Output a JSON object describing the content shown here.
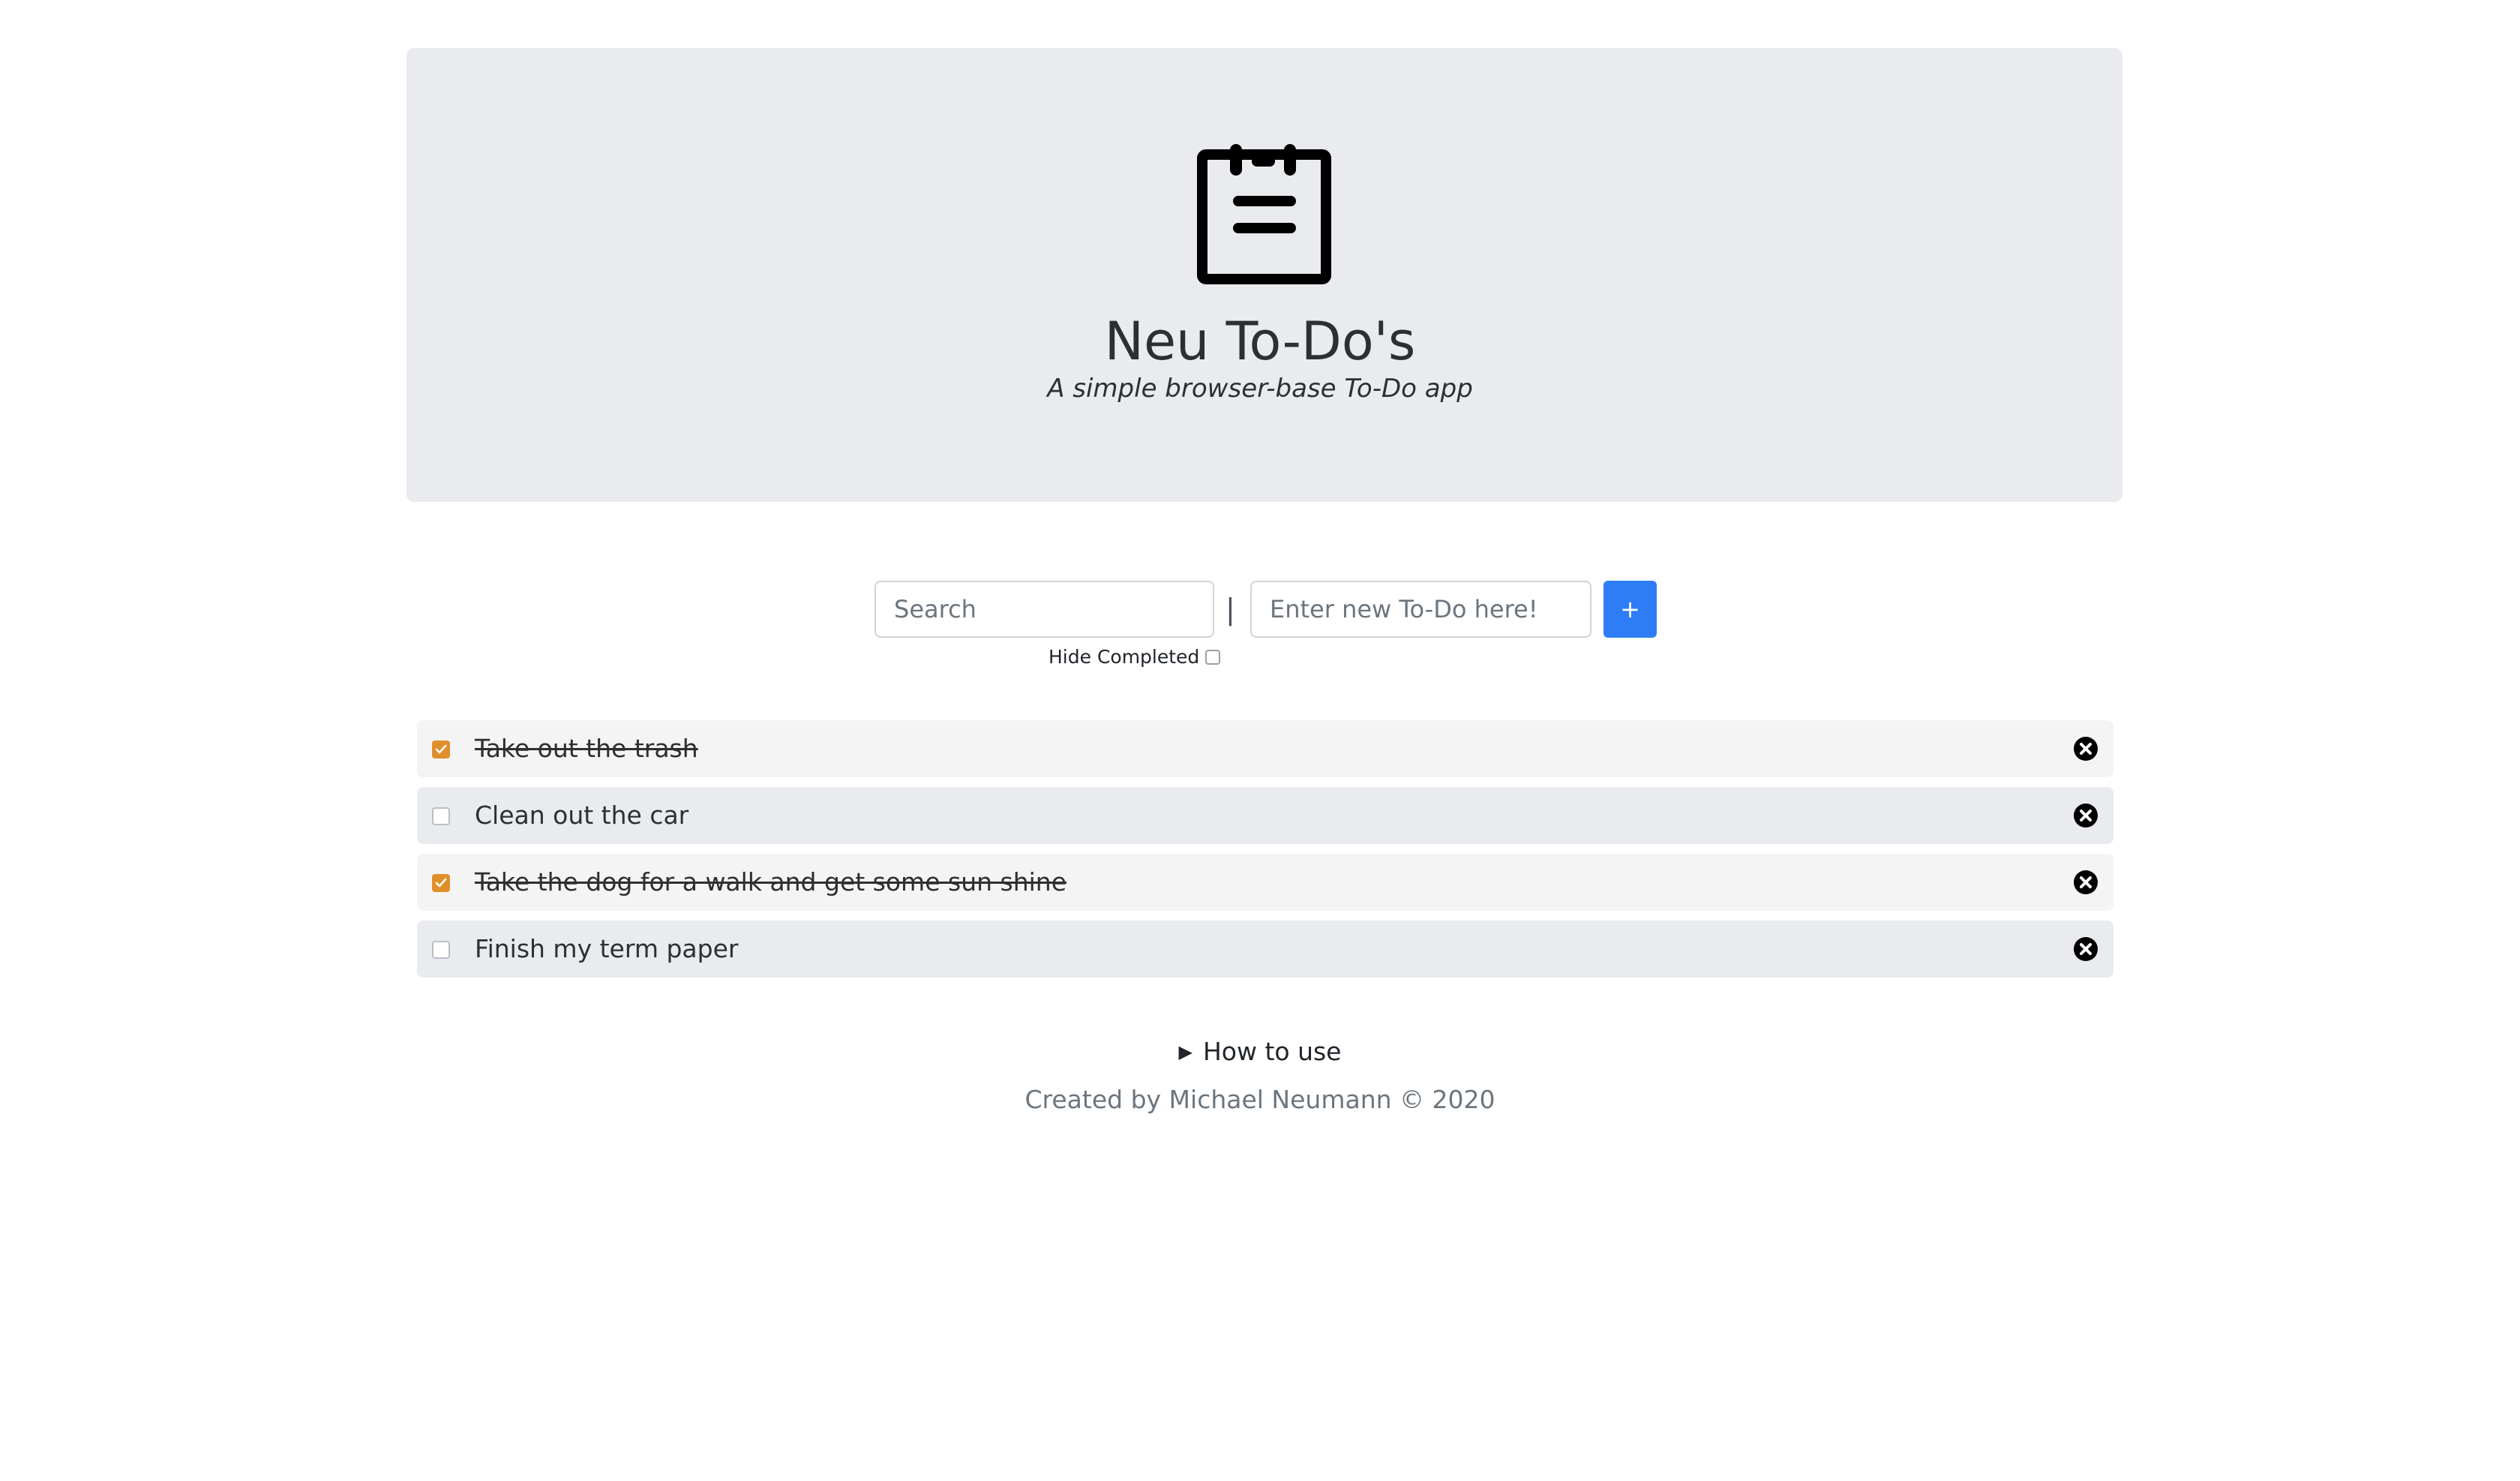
{
  "header": {
    "logo_icon": "notepad-icon",
    "title": "Neu To-Do's",
    "subtitle": "A simple browser-base To-Do app"
  },
  "form": {
    "search_placeholder": "Search",
    "separator": "|",
    "new_todo_placeholder": "Enter new To-Do here!",
    "add_button_label": "+",
    "hide_completed_label": "Hide Completed",
    "hide_completed_checked": false
  },
  "todos": [
    {
      "text": "Take out the trash",
      "completed": true
    },
    {
      "text": "Clean out the car",
      "completed": false
    },
    {
      "text": "Take the dog for a walk and get some sun shine",
      "completed": true
    },
    {
      "text": "Finish my term paper",
      "completed": false
    }
  ],
  "how_to_use": {
    "label": "How to use",
    "icon": "triangle-right-icon"
  },
  "footer": {
    "text": "Created by Michael Neumann © 2020"
  },
  "colors": {
    "accent": "#2f7df6",
    "checkbox_checked": "#e08f2a",
    "hero_background": "#e9ebee"
  }
}
